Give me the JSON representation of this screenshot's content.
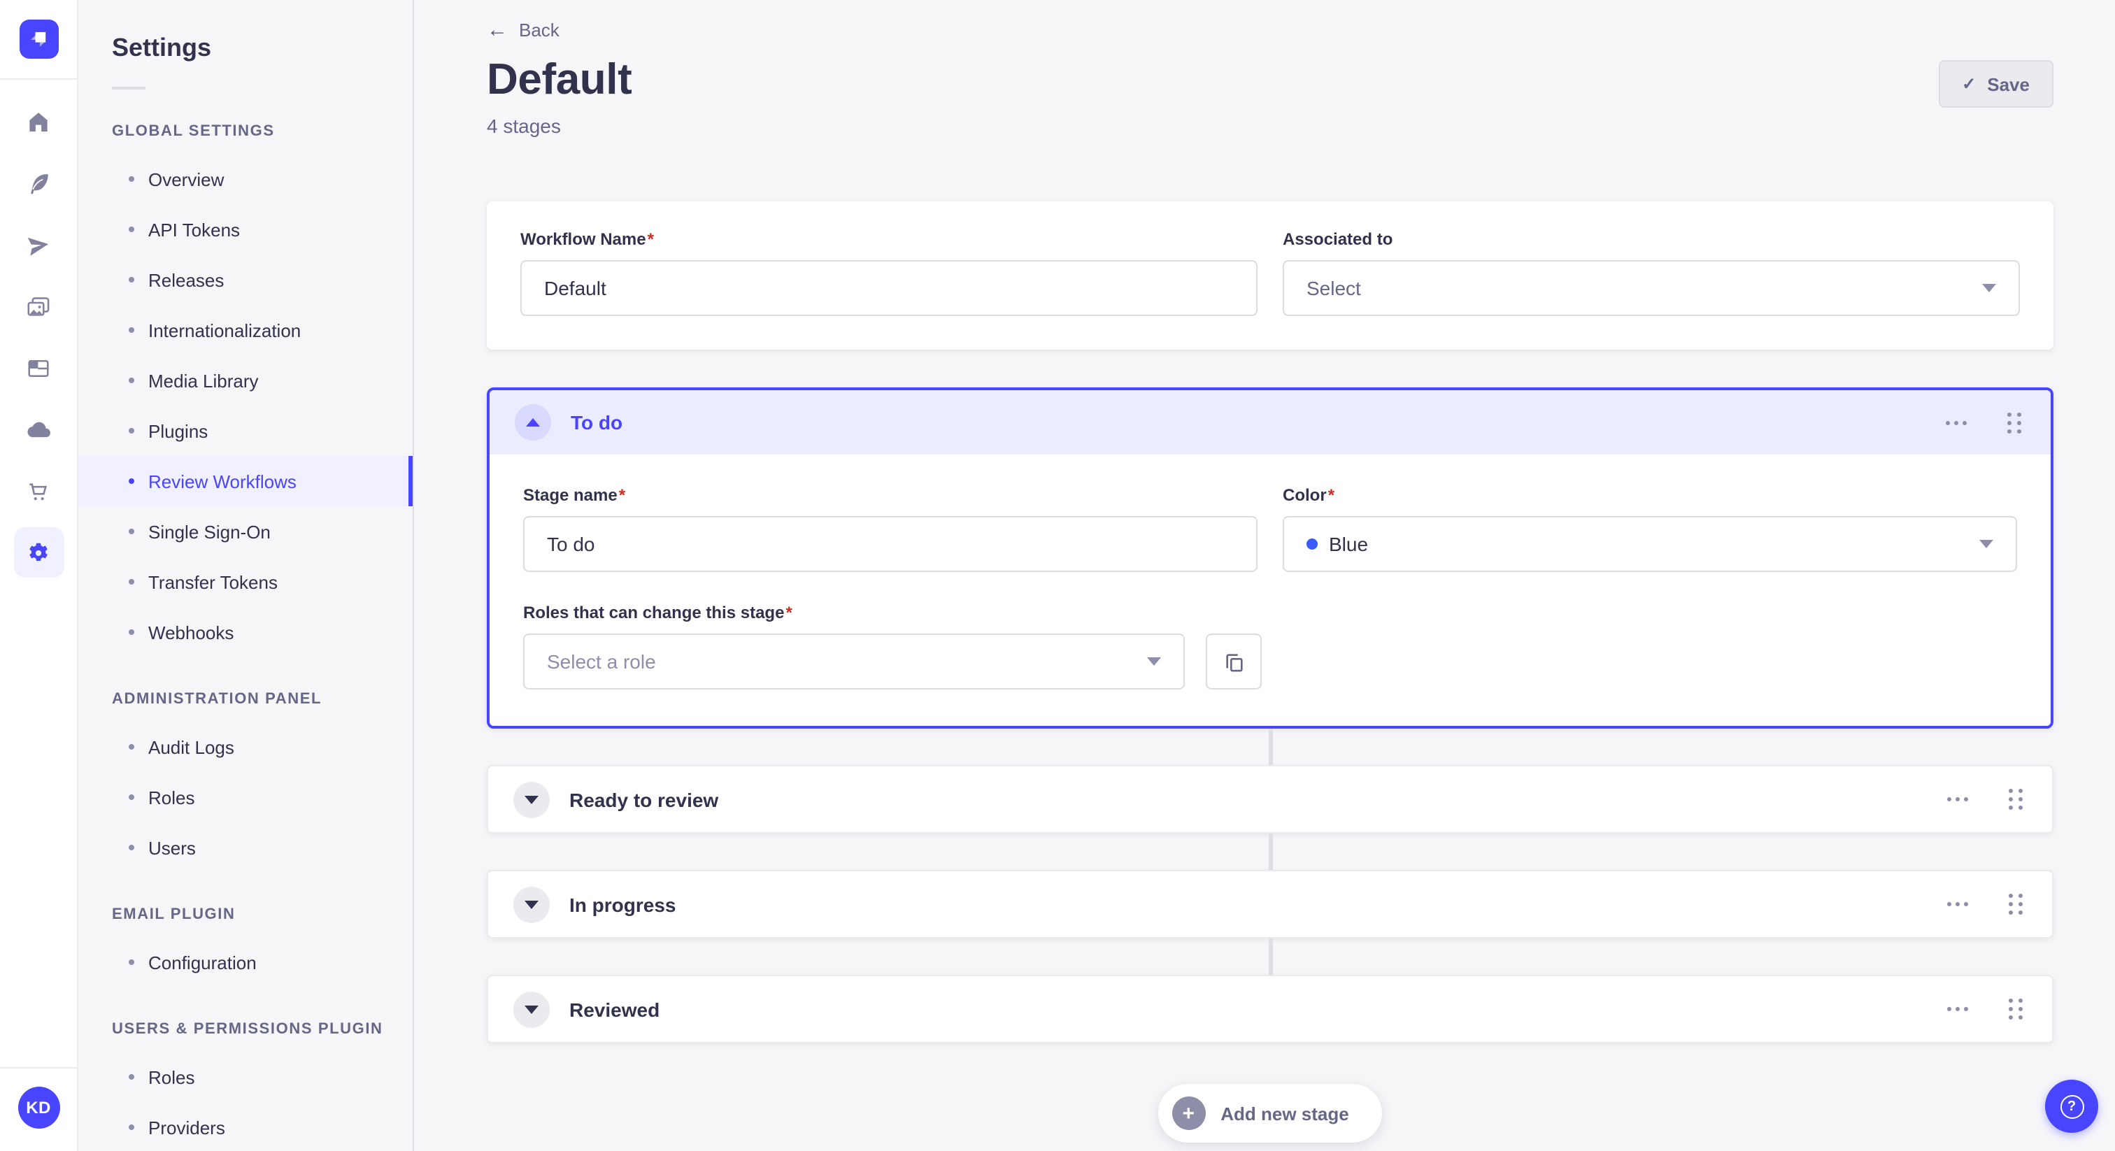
{
  "colors": {
    "primary": "#4945ff",
    "active_nav_bg": "#f0f0ff",
    "stage_header_bg": "#ececff",
    "stage_color_blue_dot": "#3b5bff",
    "required_marker_red": "#d02b20",
    "text_dark": "#32324d",
    "text_muted": "#666687"
  },
  "icons": {
    "back_arrow": "←",
    "check": "✓",
    "plus": "+",
    "question": "?"
  },
  "rail": {
    "user_initials": "KD"
  },
  "nav": {
    "title": "Settings",
    "sections": [
      {
        "label": "GLOBAL SETTINGS",
        "items": [
          {
            "label": "Overview"
          },
          {
            "label": "API Tokens"
          },
          {
            "label": "Releases"
          },
          {
            "label": "Internationalization"
          },
          {
            "label": "Media Library"
          },
          {
            "label": "Plugins"
          },
          {
            "label": "Review Workflows",
            "active": true
          },
          {
            "label": "Single Sign-On"
          },
          {
            "label": "Transfer Tokens"
          },
          {
            "label": "Webhooks"
          }
        ]
      },
      {
        "label": "ADMINISTRATION PANEL",
        "items": [
          {
            "label": "Audit Logs"
          },
          {
            "label": "Roles"
          },
          {
            "label": "Users"
          }
        ]
      },
      {
        "label": "EMAIL PLUGIN",
        "items": [
          {
            "label": "Configuration"
          }
        ]
      },
      {
        "label": "USERS & PERMISSIONS PLUGIN",
        "items": [
          {
            "label": "Roles"
          },
          {
            "label": "Providers"
          }
        ]
      }
    ]
  },
  "header": {
    "back_label": "Back",
    "title": "Default",
    "subtitle": "4 stages",
    "save_label": "Save"
  },
  "workflow_form": {
    "name_label": "Workflow Name",
    "name_value": "Default",
    "required_marker": "*",
    "associated_label": "Associated to",
    "associated_value": "Select"
  },
  "stage_form": {
    "name_label": "Stage name",
    "name_value": "To do",
    "color_label": "Color",
    "color_value": "Blue",
    "roles_label": "Roles that can change this stage",
    "roles_placeholder": "Select a role"
  },
  "stages": {
    "items": [
      {
        "name": "To do"
      },
      {
        "name": "Ready to review"
      },
      {
        "name": "In progress"
      },
      {
        "name": "Reviewed"
      }
    ]
  },
  "add_stage": {
    "label": "Add new stage"
  }
}
